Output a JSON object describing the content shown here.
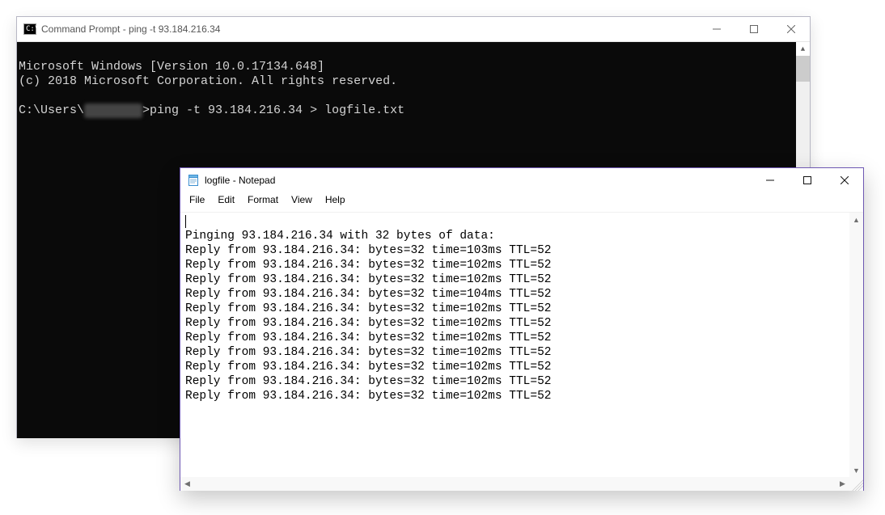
{
  "cmd": {
    "title": "Command Prompt - ping  -t 93.184.216.34",
    "icon_text": "C:\\",
    "lines": {
      "l1": "Microsoft Windows [Version 10.0.17134.648]",
      "l2": "(c) 2018 Microsoft Corporation. All rights reserved.",
      "prompt_prefix": "C:\\Users\\",
      "prompt_hidden": "████████",
      "prompt_suffix": ">ping -t 93.184.216.34 > logfile.txt"
    }
  },
  "notepad": {
    "title": "logfile - Notepad",
    "menu": {
      "file": "File",
      "edit": "Edit",
      "format": "Format",
      "view": "View",
      "help": "Help"
    },
    "content": {
      "header": "Pinging 93.184.216.34 with 32 bytes of data:",
      "r1": "Reply from 93.184.216.34: bytes=32 time=103ms TTL=52",
      "r2": "Reply from 93.184.216.34: bytes=32 time=102ms TTL=52",
      "r3": "Reply from 93.184.216.34: bytes=32 time=102ms TTL=52",
      "r4": "Reply from 93.184.216.34: bytes=32 time=104ms TTL=52",
      "r5": "Reply from 93.184.216.34: bytes=32 time=102ms TTL=52",
      "r6": "Reply from 93.184.216.34: bytes=32 time=102ms TTL=52",
      "r7": "Reply from 93.184.216.34: bytes=32 time=102ms TTL=52",
      "r8": "Reply from 93.184.216.34: bytes=32 time=102ms TTL=52",
      "r9": "Reply from 93.184.216.34: bytes=32 time=102ms TTL=52",
      "r10": "Reply from 93.184.216.34: bytes=32 time=102ms TTL=52",
      "r11": "Reply from 93.184.216.34: bytes=32 time=102ms TTL=52"
    }
  }
}
